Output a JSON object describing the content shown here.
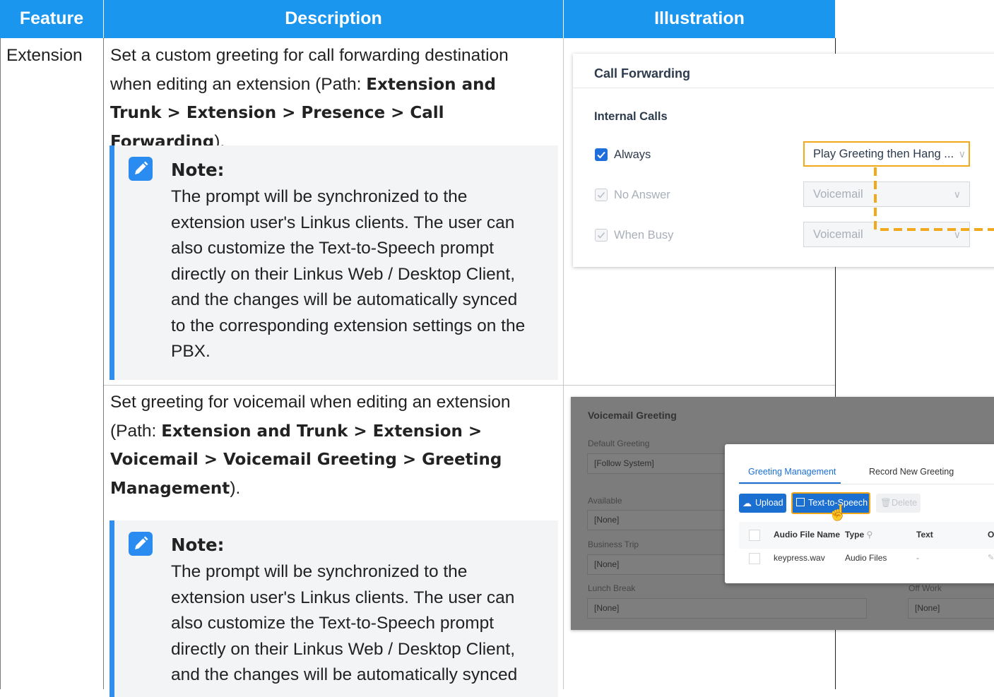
{
  "table": {
    "headers": [
      "Feature",
      "Description",
      "Illustration"
    ],
    "rows": [
      {
        "feature": "Extension",
        "desc_lines": [
          {
            "plain": "Set a custom greeting for call forwarding destination"
          },
          {
            "plain": "when editing an extension (Path: ",
            "bold": "Extension and"
          },
          {
            "bold": "Trunk > Extension > Presence > Call Forwarding",
            "plain_after": ")."
          }
        ],
        "note_title": "Note:",
        "note_lines": [
          "The prompt will be synchronized to the",
          "extension user's Linkus clients. The user can",
          "also customize the Text-to-Speech prompt",
          "directly on their Linkus Web / Desktop Client,",
          "and the changes will be automatically synced",
          "to the corresponding extension settings on the",
          "PBX."
        ]
      },
      {
        "feature": "",
        "desc_lines": [
          {
            "plain": "Set greeting for voicemail when editing an extension"
          },
          {
            "plain": "(Path: ",
            "bold": "Extension and Trunk > Extension >"
          },
          {
            "bold": "Voicemail > Voicemail Greeting > Greeting"
          },
          {
            "bold": "Management",
            "plain_after": ")."
          }
        ],
        "note_title": "Note:",
        "note_lines": [
          "The prompt will be synchronized to the",
          "extension user's Linkus clients. The user can",
          "also customize the Text-to-Speech prompt",
          "directly on their Linkus Web / Desktop Client,",
          "and the changes will be automatically synced"
        ]
      }
    ]
  },
  "illustration1": {
    "title": "Call Forwarding",
    "section": "Internal Calls",
    "rows": [
      {
        "label": "Always",
        "value": "Play Greeting then Hang ...",
        "checked": true,
        "disabled": false
      },
      {
        "label": "No Answer",
        "value": "Voicemail",
        "checked": true,
        "disabled": true
      },
      {
        "label": "When Busy",
        "value": "Voicemail",
        "checked": true,
        "disabled": true
      }
    ],
    "highlight_color": "#f2a81b"
  },
  "illustration2": {
    "title": "Voicemail Greeting",
    "fields": [
      {
        "label": "Default Greeting",
        "value": "[Follow System]"
      },
      {
        "label": "Available",
        "value": "[None]"
      },
      {
        "label": "Business Trip",
        "value": "[None]"
      },
      {
        "label": "Lunch Break",
        "value": "[None]"
      },
      {
        "label": "Off Work",
        "value": "[None]"
      }
    ],
    "dialog": {
      "tabs": [
        "Greeting Management",
        "Record New Greeting"
      ],
      "buttons": {
        "upload": "Upload",
        "tts": "Text-to-Speech",
        "delete": "Delete"
      },
      "columns": [
        "Audio File Name",
        "Type",
        "Text",
        "O"
      ],
      "row": {
        "name": "keypress.wav",
        "type": "Audio Files",
        "text": "-"
      }
    }
  }
}
